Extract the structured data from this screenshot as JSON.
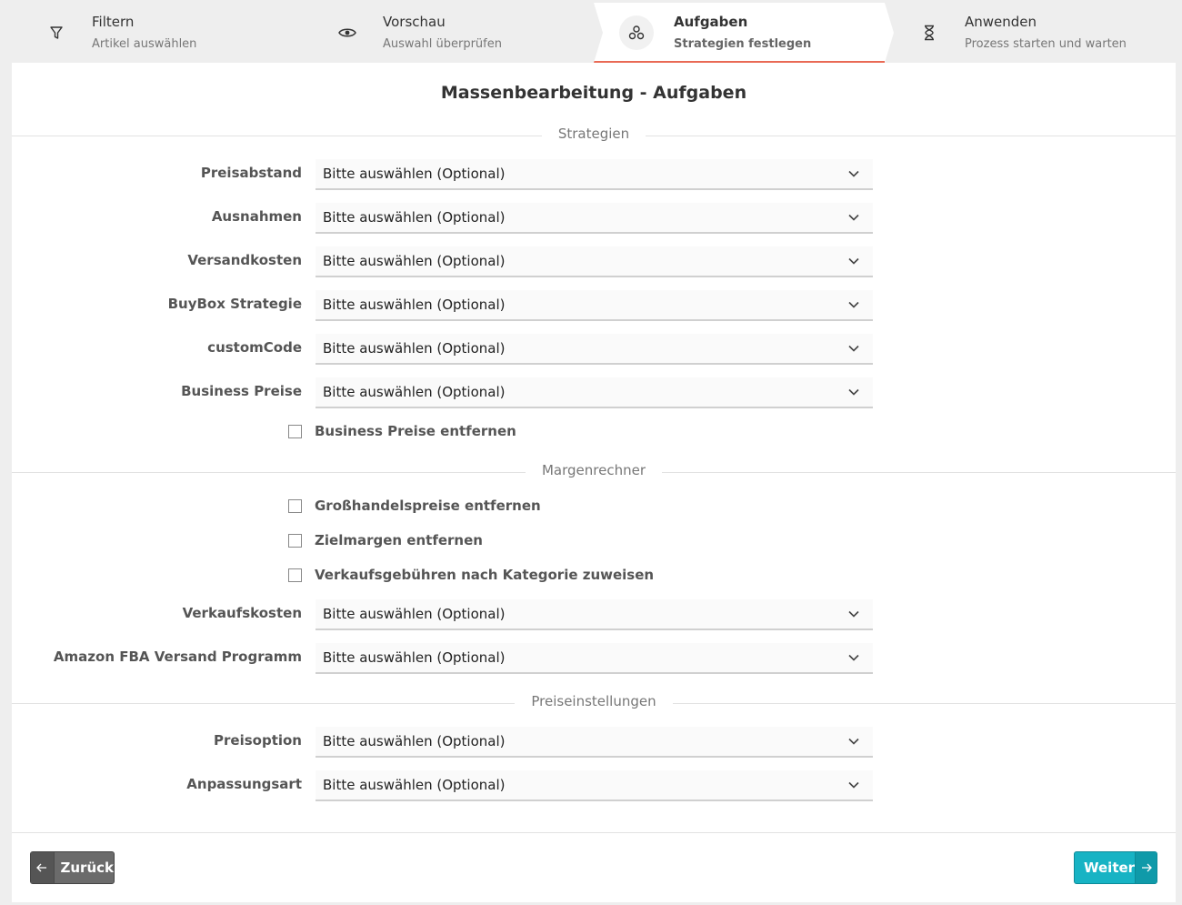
{
  "stepper": {
    "steps": [
      {
        "title": "Filtern",
        "subtitle": "Artikel auswählen",
        "icon": "filter-icon"
      },
      {
        "title": "Vorschau",
        "subtitle": "Auswahl überprüfen",
        "icon": "eye-icon"
      },
      {
        "title": "Aufgaben",
        "subtitle": "Strategien festlegen",
        "icon": "tasks-icon",
        "active": true
      },
      {
        "title": "Anwenden",
        "subtitle": "Prozess starten und warten",
        "icon": "hourglass-icon"
      }
    ]
  },
  "card": {
    "title": "Massenbearbeitung - Aufgaben"
  },
  "sections": {
    "strategien": {
      "label": "Strategien",
      "fields": [
        {
          "label": "Preisabstand",
          "value": "Bitte auswählen (Optional)"
        },
        {
          "label": "Ausnahmen",
          "value": "Bitte auswählen (Optional)"
        },
        {
          "label": "Versandkosten",
          "value": "Bitte auswählen (Optional)"
        },
        {
          "label": "BuyBox Strategie",
          "value": "Bitte auswählen (Optional)"
        },
        {
          "label": "customCode",
          "value": "Bitte auswählen (Optional)"
        },
        {
          "label": "Business Preise",
          "value": "Bitte auswählen (Optional)"
        }
      ],
      "checkboxes": [
        {
          "label": "Business Preise entfernen",
          "checked": false
        }
      ]
    },
    "margenrechner": {
      "label": "Margenrechner",
      "checkboxes": [
        {
          "label": "Großhandelspreise entfernen",
          "checked": false
        },
        {
          "label": "Zielmargen entfernen",
          "checked": false
        },
        {
          "label": "Verkaufsgebühren nach Kategorie zuweisen",
          "checked": false
        }
      ],
      "fields": [
        {
          "label": "Verkaufskosten",
          "value": "Bitte auswählen (Optional)"
        },
        {
          "label": "Amazon FBA Versand Programm",
          "value": "Bitte auswählen (Optional)"
        }
      ]
    },
    "preiseinstellungen": {
      "label": "Preiseinstellungen",
      "fields": [
        {
          "label": "Preisoption",
          "value": "Bitte auswählen (Optional)"
        },
        {
          "label": "Anpassungsart",
          "value": "Bitte auswählen (Optional)"
        }
      ]
    }
  },
  "footer": {
    "back_label": "Zurück",
    "next_label": "Weiter"
  },
  "colors": {
    "accent": "#17b3c4",
    "active_step_underline": "#e96a55",
    "back_button": "#6b6b6b"
  }
}
